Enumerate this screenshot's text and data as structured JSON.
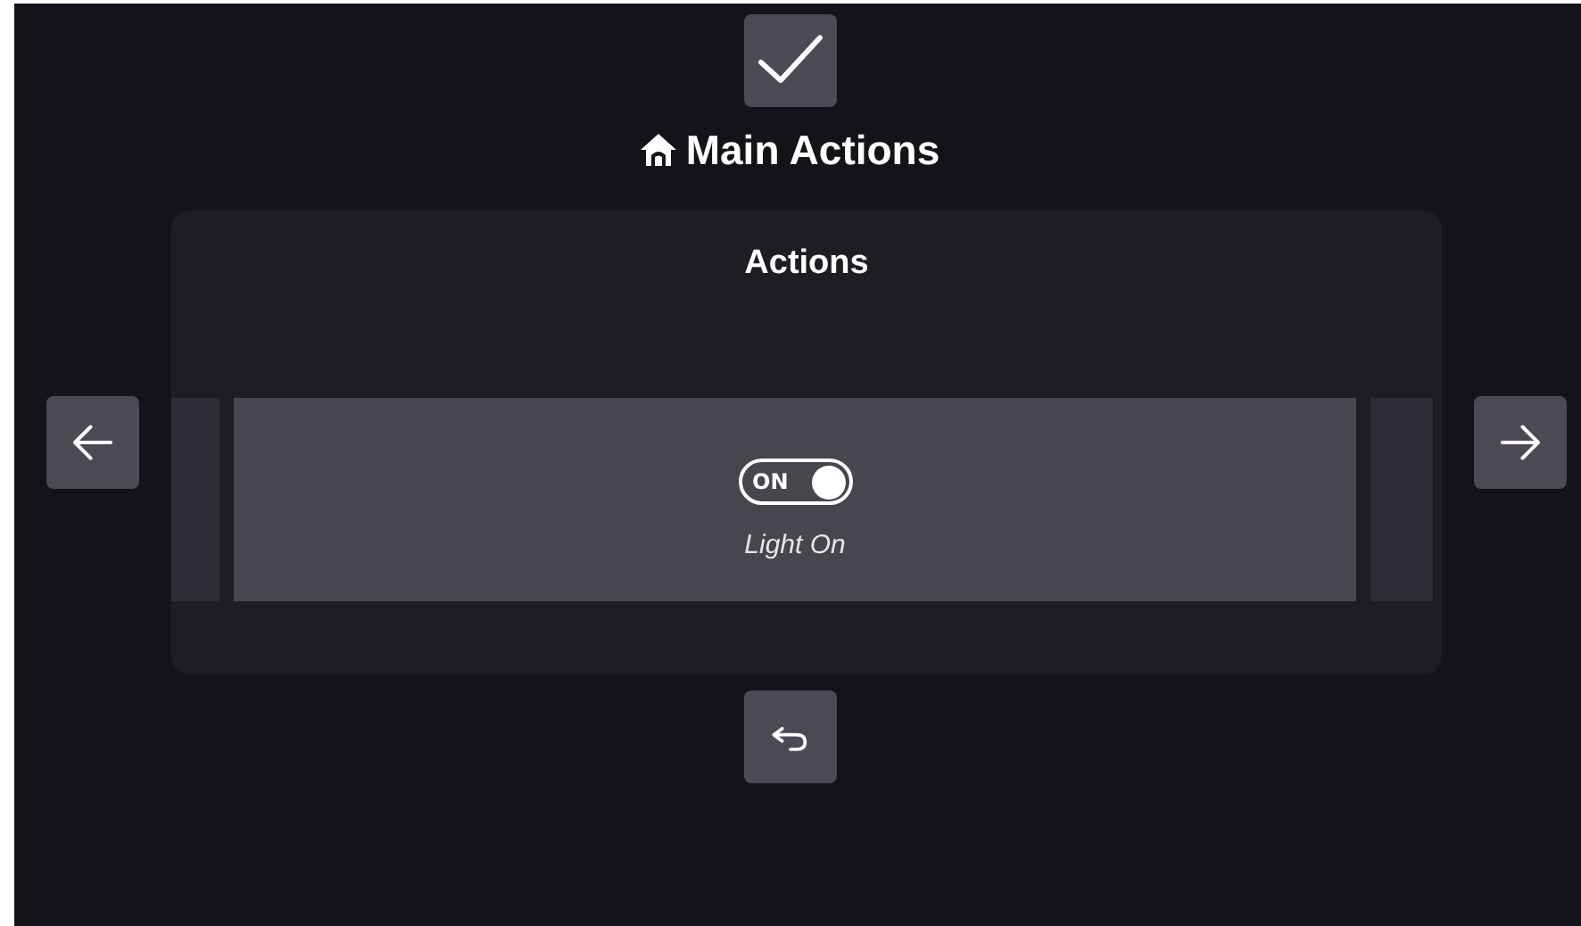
{
  "header": {
    "title": "Main Actions"
  },
  "panel": {
    "title": "Actions"
  },
  "actions": [
    {
      "kind": "toggle",
      "label": "Light On",
      "on": true,
      "switch_text": "ON"
    }
  ]
}
